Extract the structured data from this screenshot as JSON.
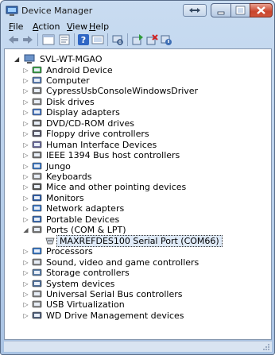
{
  "window": {
    "title": "Device Manager"
  },
  "menu": [
    {
      "label": "File",
      "key": "F"
    },
    {
      "label": "Action",
      "key": "A"
    },
    {
      "label": "View",
      "key": "V"
    },
    {
      "label": "Help",
      "key": "H"
    }
  ],
  "tree": {
    "root": "SVL-WT-MGAO",
    "categories": [
      {
        "label": "Android Device",
        "icon": "android-device-icon"
      },
      {
        "label": "Computer",
        "icon": "computer-icon"
      },
      {
        "label": "CypressUsbConsoleWindowsDriver",
        "icon": "usb-driver-icon"
      },
      {
        "label": "Disk drives",
        "icon": "disk-drive-icon"
      },
      {
        "label": "Display adapters",
        "icon": "display-adapter-icon"
      },
      {
        "label": "DVD/CD-ROM drives",
        "icon": "dvd-drive-icon"
      },
      {
        "label": "Floppy drive controllers",
        "icon": "floppy-controller-icon"
      },
      {
        "label": "Human Interface Devices",
        "icon": "hid-icon"
      },
      {
        "label": "IEEE 1394 Bus host controllers",
        "icon": "ieee1394-icon"
      },
      {
        "label": "Jungo",
        "icon": "jungo-icon"
      },
      {
        "label": "Keyboards",
        "icon": "keyboard-icon"
      },
      {
        "label": "Mice and other pointing devices",
        "icon": "mouse-icon"
      },
      {
        "label": "Monitors",
        "icon": "monitor-icon"
      },
      {
        "label": "Network adapters",
        "icon": "network-adapter-icon"
      },
      {
        "label": "Portable Devices",
        "icon": "portable-device-icon"
      },
      {
        "label": "Ports (COM & LPT)",
        "icon": "port-icon",
        "expanded": true,
        "children": [
          {
            "label": "MAXREFDES100 Serial Port (COM66)",
            "icon": "serial-port-icon",
            "selected": true
          }
        ]
      },
      {
        "label": "Processors",
        "icon": "processor-icon"
      },
      {
        "label": "Sound, video and game controllers",
        "icon": "sound-icon"
      },
      {
        "label": "Storage controllers",
        "icon": "storage-controller-icon"
      },
      {
        "label": "System devices",
        "icon": "system-device-icon"
      },
      {
        "label": "Universal Serial Bus controllers",
        "icon": "usb-controller-icon"
      },
      {
        "label": "USB Virtualization",
        "icon": "usb-virtualization-icon"
      },
      {
        "label": "WD Drive Management devices",
        "icon": "wd-drive-icon"
      }
    ]
  }
}
